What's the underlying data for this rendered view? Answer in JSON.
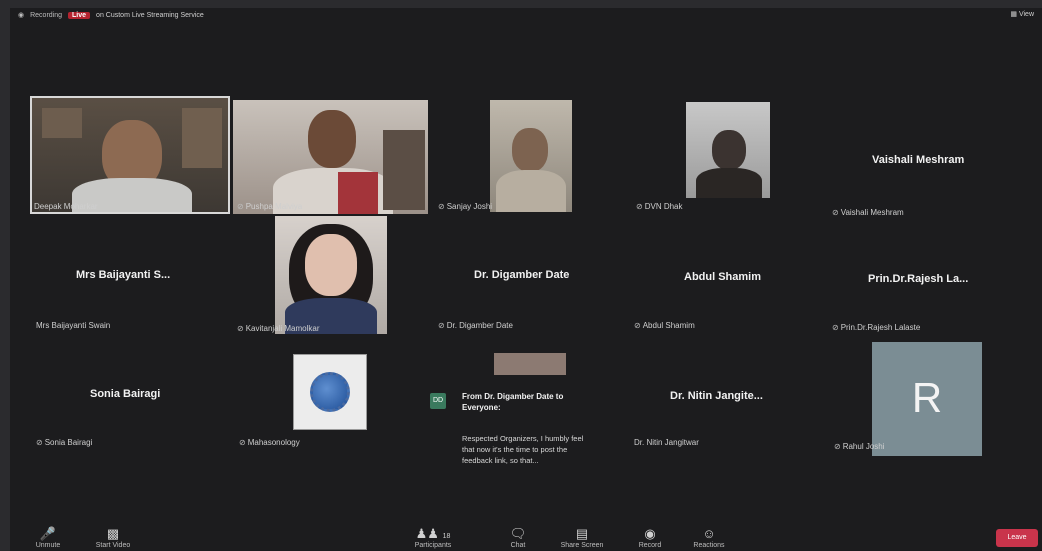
{
  "topbar": {
    "rec_label": "Live",
    "status": "Recording",
    "live_title": "on Custom Live Streaming Service",
    "view_label": "View"
  },
  "participants": [
    {
      "label": "Deepak Moharkar",
      "type": "video"
    },
    {
      "label": "Pushpa Malviya",
      "type": "video"
    },
    {
      "label": "Sanjay Joshi",
      "type": "video"
    },
    {
      "label": "DVN Dhak",
      "type": "video"
    },
    {
      "display": "Vaishali Meshram",
      "label": "Vaishali Meshram",
      "type": "name"
    },
    {
      "display": "Mrs Baijayanti S...",
      "label": "Mrs Baijayanti Swain",
      "type": "name"
    },
    {
      "label": "Kavitanjali Mamolkar",
      "type": "video"
    },
    {
      "display": "Dr. Digamber Date",
      "label": "Dr. Digamber Date",
      "type": "name"
    },
    {
      "display": "Abdul Shamim",
      "label": "Abdul Shamim",
      "type": "name"
    },
    {
      "display": "Prin.Dr.Rajesh La...",
      "label": "Prin.Dr.Rajesh Lalaste",
      "type": "name"
    },
    {
      "display": "Sonia Bairagi",
      "label": "Sonia Bairagi",
      "type": "name"
    },
    {
      "label": "Mahasonology",
      "type": "logo"
    },
    {
      "display": "Dr. Nitin Jangite...",
      "label": "Dr. Nitin Jangitwar",
      "type": "name"
    },
    {
      "avatar_letter": "R",
      "label": "Rahul Joshi",
      "type": "avatar"
    }
  ],
  "chat": {
    "avatar": "DD",
    "from": "From Dr. Digamber Date to Everyone:",
    "message": "Respected Organizers, I humbly feel that now it's the time to post the feedback link, so that..."
  },
  "toolbar": {
    "buttons": [
      {
        "label": "Unmute",
        "icon": "microphone-icon"
      },
      {
        "label": "Start Video",
        "icon": "video-camera-icon"
      },
      {
        "label": "Participants",
        "icon": "participants-icon",
        "count": "18"
      },
      {
        "label": "Chat",
        "icon": "chat-icon"
      },
      {
        "label": "Share Screen",
        "icon": "share-screen-icon"
      },
      {
        "label": "Record",
        "icon": "record-icon"
      },
      {
        "label": "Reactions",
        "icon": "reactions-icon"
      }
    ],
    "leave_label": "Leave"
  },
  "colors": {
    "background": "#1c1c1e",
    "record_red": "#b4232f",
    "avatar_bg": "#7b8d94",
    "leave_red": "#c9344b"
  }
}
